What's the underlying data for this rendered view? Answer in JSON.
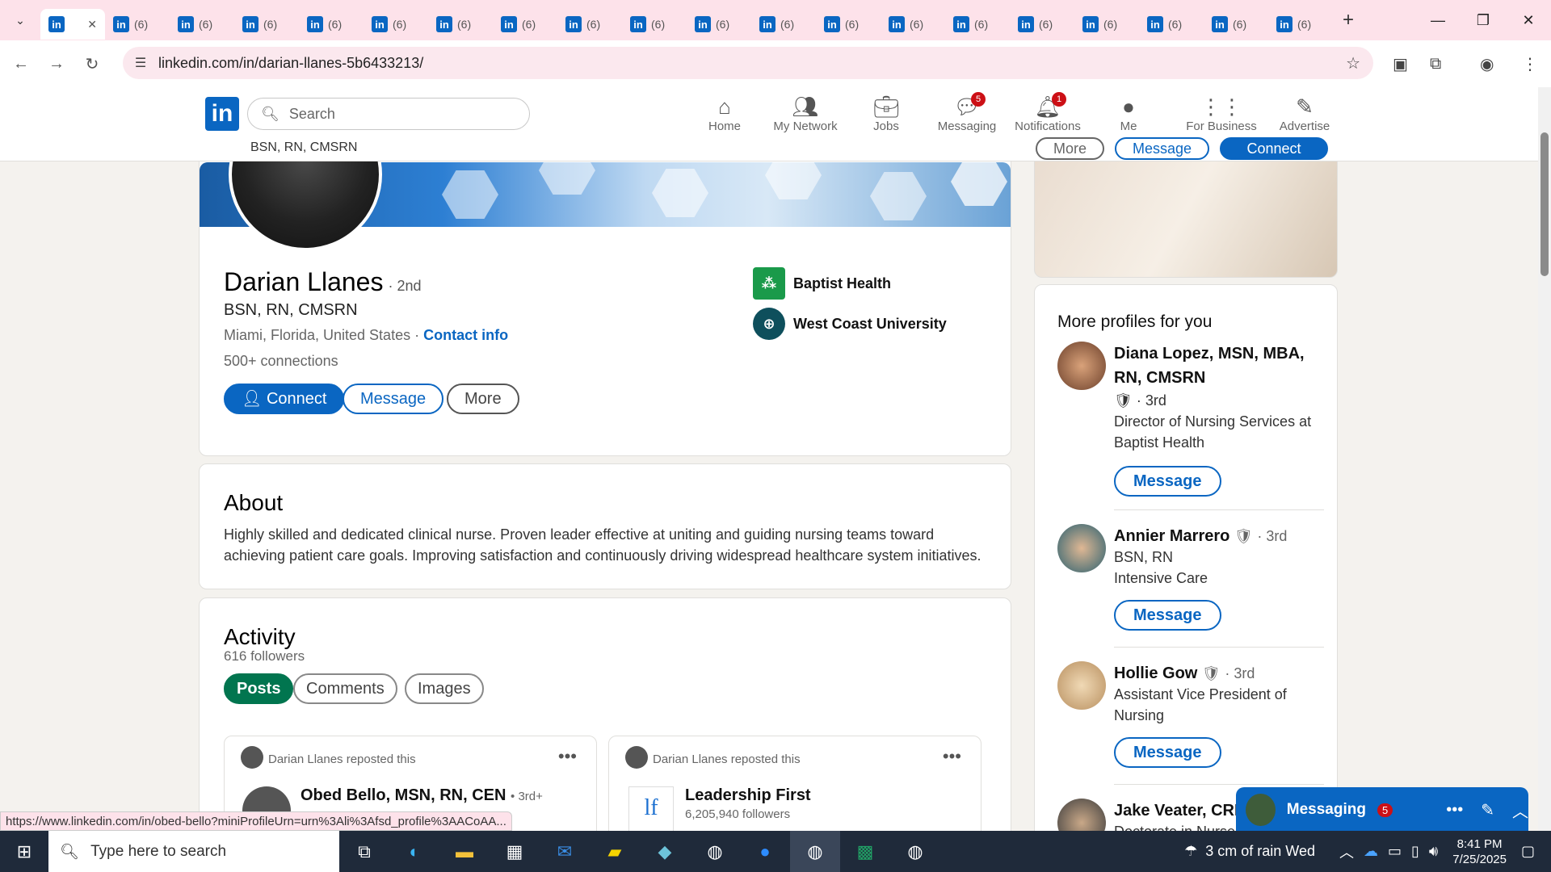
{
  "browser": {
    "tab_title_count": "(6)",
    "tab_count": 20,
    "url": "linkedin.com/in/darian-llanes-5b6433213/",
    "status_url": "https://www.linkedin.com/in/obed-bello?miniProfileUrn=urn%3Ali%3Afsd_profile%3AACoAA..."
  },
  "nav": {
    "logo": "in",
    "search_placeholder": "Search",
    "items": [
      {
        "label": "Home",
        "icon": "home-icon",
        "badge": ""
      },
      {
        "label": "My Network",
        "icon": "network-icon",
        "badge": ""
      },
      {
        "label": "Jobs",
        "icon": "briefcase-icon",
        "badge": ""
      },
      {
        "label": "Messaging",
        "icon": "chat-icon",
        "badge": "5"
      },
      {
        "label": "Notifications",
        "icon": "bell-icon",
        "badge": "1"
      },
      {
        "label": "Me",
        "icon": "avatar-icon",
        "badge": ""
      },
      {
        "label": "For Business",
        "icon": "grid-icon",
        "badge": ""
      },
      {
        "label": "Advertise",
        "icon": "advertise-icon",
        "badge": ""
      }
    ],
    "sticky_subtitle": "BSN, RN, CMSRN",
    "sticky_more": "More",
    "sticky_message": "Message",
    "sticky_connect": "Connect"
  },
  "profile": {
    "name": "Darian Llanes",
    "degree": "· 2nd",
    "headline": "BSN, RN, CMSRN",
    "location": "Miami, Florida, United States ·",
    "contact_info": "Contact info",
    "connections": "500+ connections",
    "connect_label": "Connect",
    "message_label": "Message",
    "more_label": "More",
    "orgs": [
      "Baptist Health",
      "West Coast University"
    ]
  },
  "about": {
    "title": "About",
    "text": "Highly skilled and dedicated clinical nurse. Proven leader effective at uniting and guiding nursing teams toward achieving patient care goals. Improving satisfaction and continuously driving widespread healthcare system initiatives."
  },
  "activity": {
    "title": "Activity",
    "followers": "616 followers",
    "tabs": [
      "Posts",
      "Comments",
      "Images"
    ],
    "posts": [
      {
        "reposted": "Darian Llanes reposted this",
        "author": "Obed Bello, MSN, RN, CEN",
        "meta": "• 3rd+"
      },
      {
        "reposted": "Darian Llanes reposted this",
        "author": "Leadership First",
        "meta": "6,205,940 followers"
      }
    ]
  },
  "sidebar": {
    "title": "More profiles for you",
    "profiles": [
      {
        "name": "Diana Lopez, MSN, MBA, RN, CMSRN",
        "degree": "· 3rd",
        "desc": "Director of Nursing Services at Baptist Health",
        "button": "Message"
      },
      {
        "name": "Annier Marrero",
        "degree": "· 3rd",
        "desc": "BSN, RN\nIntensive Care",
        "button": "Message"
      },
      {
        "name": "Hollie Gow",
        "degree": "· 3rd",
        "desc": "Assistant Vice President of Nursing",
        "button": "Message"
      },
      {
        "name": "Jake Veater, CRN",
        "degree": "",
        "desc": "Doctorate in Nurse...",
        "button": ""
      }
    ]
  },
  "messaging": {
    "label": "Messaging",
    "badge": "5"
  },
  "taskbar": {
    "search_placeholder": "Type here to search",
    "weather": "3 cm of rain Wed",
    "time": "8:41 PM",
    "date": "7/25/2025"
  }
}
